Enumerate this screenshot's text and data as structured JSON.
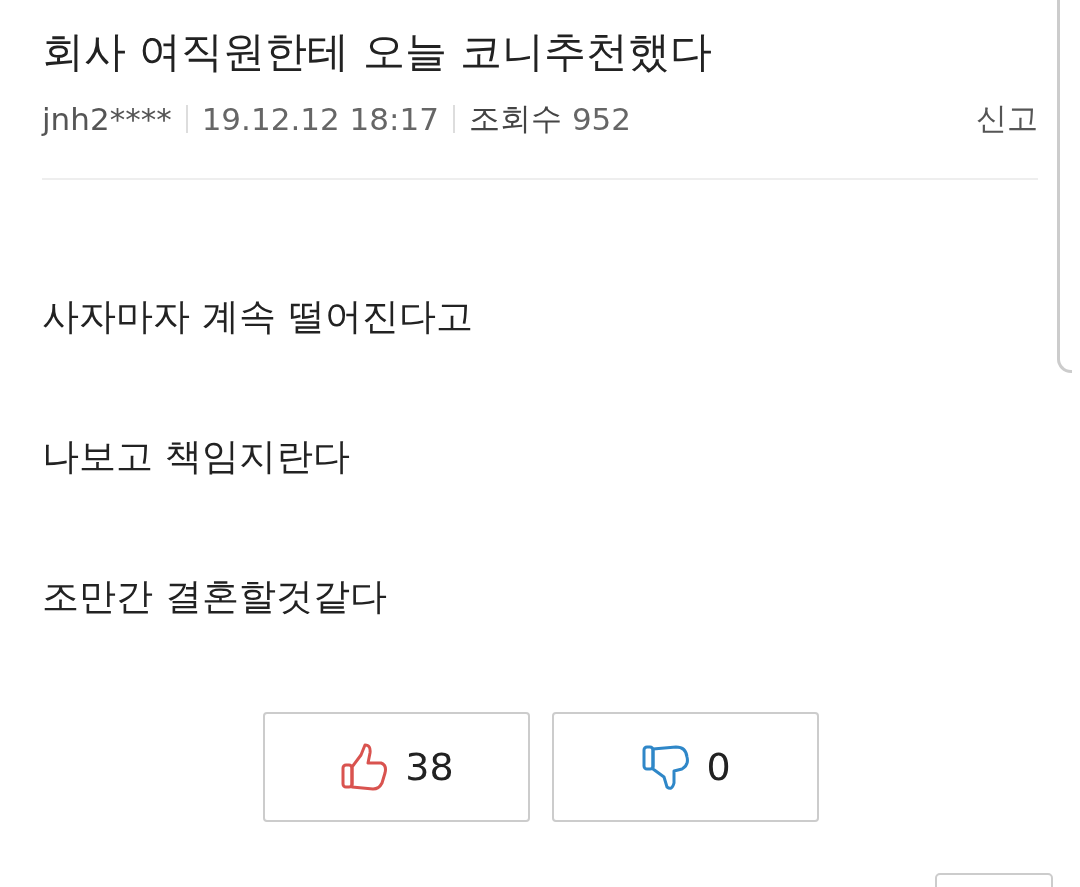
{
  "post": {
    "title": "회사 여직원한테 오늘 코니추천했다",
    "author": "jnh2****",
    "date": "19.12.12 18:17",
    "views_label": "조회수",
    "views": "952",
    "report": "신고"
  },
  "body": [
    "사자마자 계속 떨어진다고",
    "나보고 책임지란다",
    "조만간 결혼할것같다"
  ],
  "votes": [
    {
      "kind": "up",
      "count": "38"
    },
    {
      "kind": "down",
      "count": "0"
    }
  ]
}
